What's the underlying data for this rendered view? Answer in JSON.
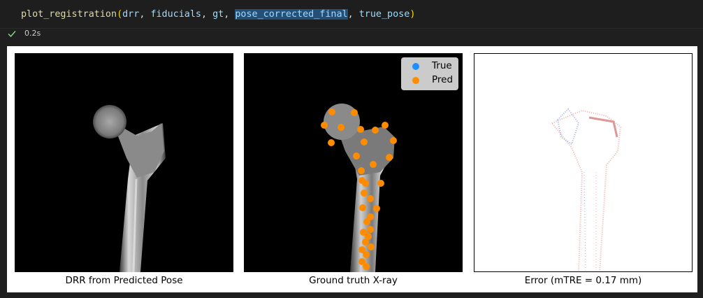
{
  "code": {
    "function_name": "plot_registration",
    "open_paren": "(",
    "arg1": "drr",
    "arg2": "fiducials",
    "arg3": "gt",
    "arg4": "pose_corrected_final",
    "arg5": "true_pose",
    "close_paren": ")",
    "sep": ", "
  },
  "status": {
    "state": "success",
    "elapsed": "0.2s"
  },
  "figure": {
    "panels": [
      {
        "caption": "DRR from Predicted Pose"
      },
      {
        "caption": "Ground truth X-ray"
      },
      {
        "caption": "Error (mTRE = 0.17 mm)"
      }
    ],
    "legend": {
      "items": [
        {
          "label": "True",
          "color": "#1f8fff"
        },
        {
          "label": "Pred",
          "color": "#ff8c00"
        }
      ]
    }
  },
  "colors": {
    "background": "#1f1f1f",
    "true_marker": "#1f8fff",
    "pred_marker": "#ff8c00",
    "success": "#89d185"
  }
}
